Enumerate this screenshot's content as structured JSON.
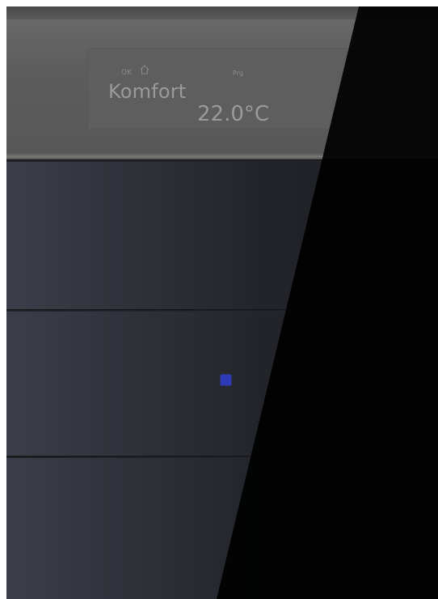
{
  "display": {
    "status_ok": "OK",
    "home_icon": "house-icon",
    "program_label": "Prg",
    "mode": "Komfort",
    "temperature": "22.0°C",
    "arrow_icon": "up-arrow-icon"
  },
  "buttons": [
    {
      "name": "button-1",
      "led": false
    },
    {
      "name": "button-2",
      "led": true,
      "led_color": "#2d3bb8"
    },
    {
      "name": "button-3",
      "led": false
    }
  ],
  "colors": {
    "glass": "#2d2f37",
    "display_glass": "#5d5d5d",
    "lcd_text": "#9a9a9a",
    "led": "#2d3bb8"
  }
}
